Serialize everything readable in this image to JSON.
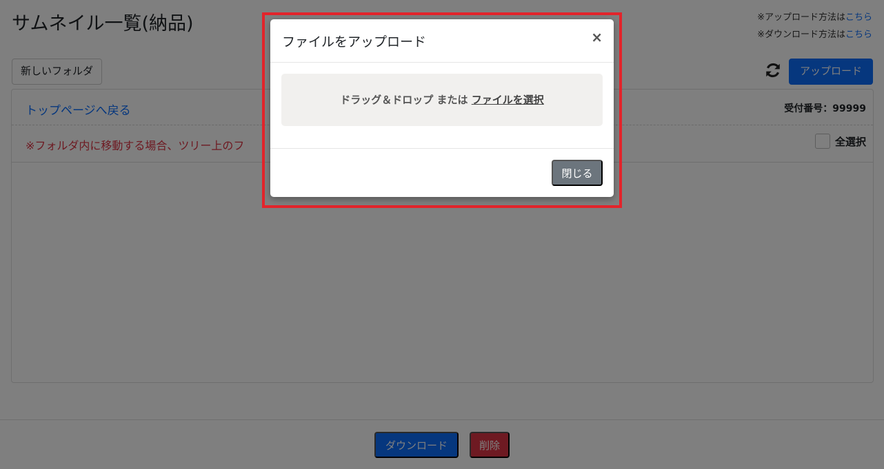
{
  "header": {
    "title": "サムネイル一覧(納品)",
    "upload_help_prefix": "※アップロード方法は",
    "upload_help_link": "こちら",
    "download_help_prefix": "※ダウンロード方法は",
    "download_help_link": "こちら"
  },
  "toolbar": {
    "new_folder_label": "新しいフォルダ",
    "upload_label": "アップロード"
  },
  "panel": {
    "back_link": "トップページへ戻る",
    "receipt_number": "受付番号：99999",
    "notice": "※フォルダ内に移動する場合、ツリー上のフ",
    "select_all_label": "全選択"
  },
  "footer": {
    "download_label": "ダウンロード",
    "delete_label": "削除"
  },
  "modal": {
    "title": "ファイルをアップロード",
    "close_symbol": "×",
    "drop_text": "ドラッグ＆ドロップ または ",
    "pick_file_link": "ファイルを選択",
    "close_button_label": "閉じる"
  },
  "colors": {
    "primary": "#0d6efd",
    "danger": "#dc3545",
    "secondary": "#6c757d",
    "highlight": "#e3242b"
  }
}
